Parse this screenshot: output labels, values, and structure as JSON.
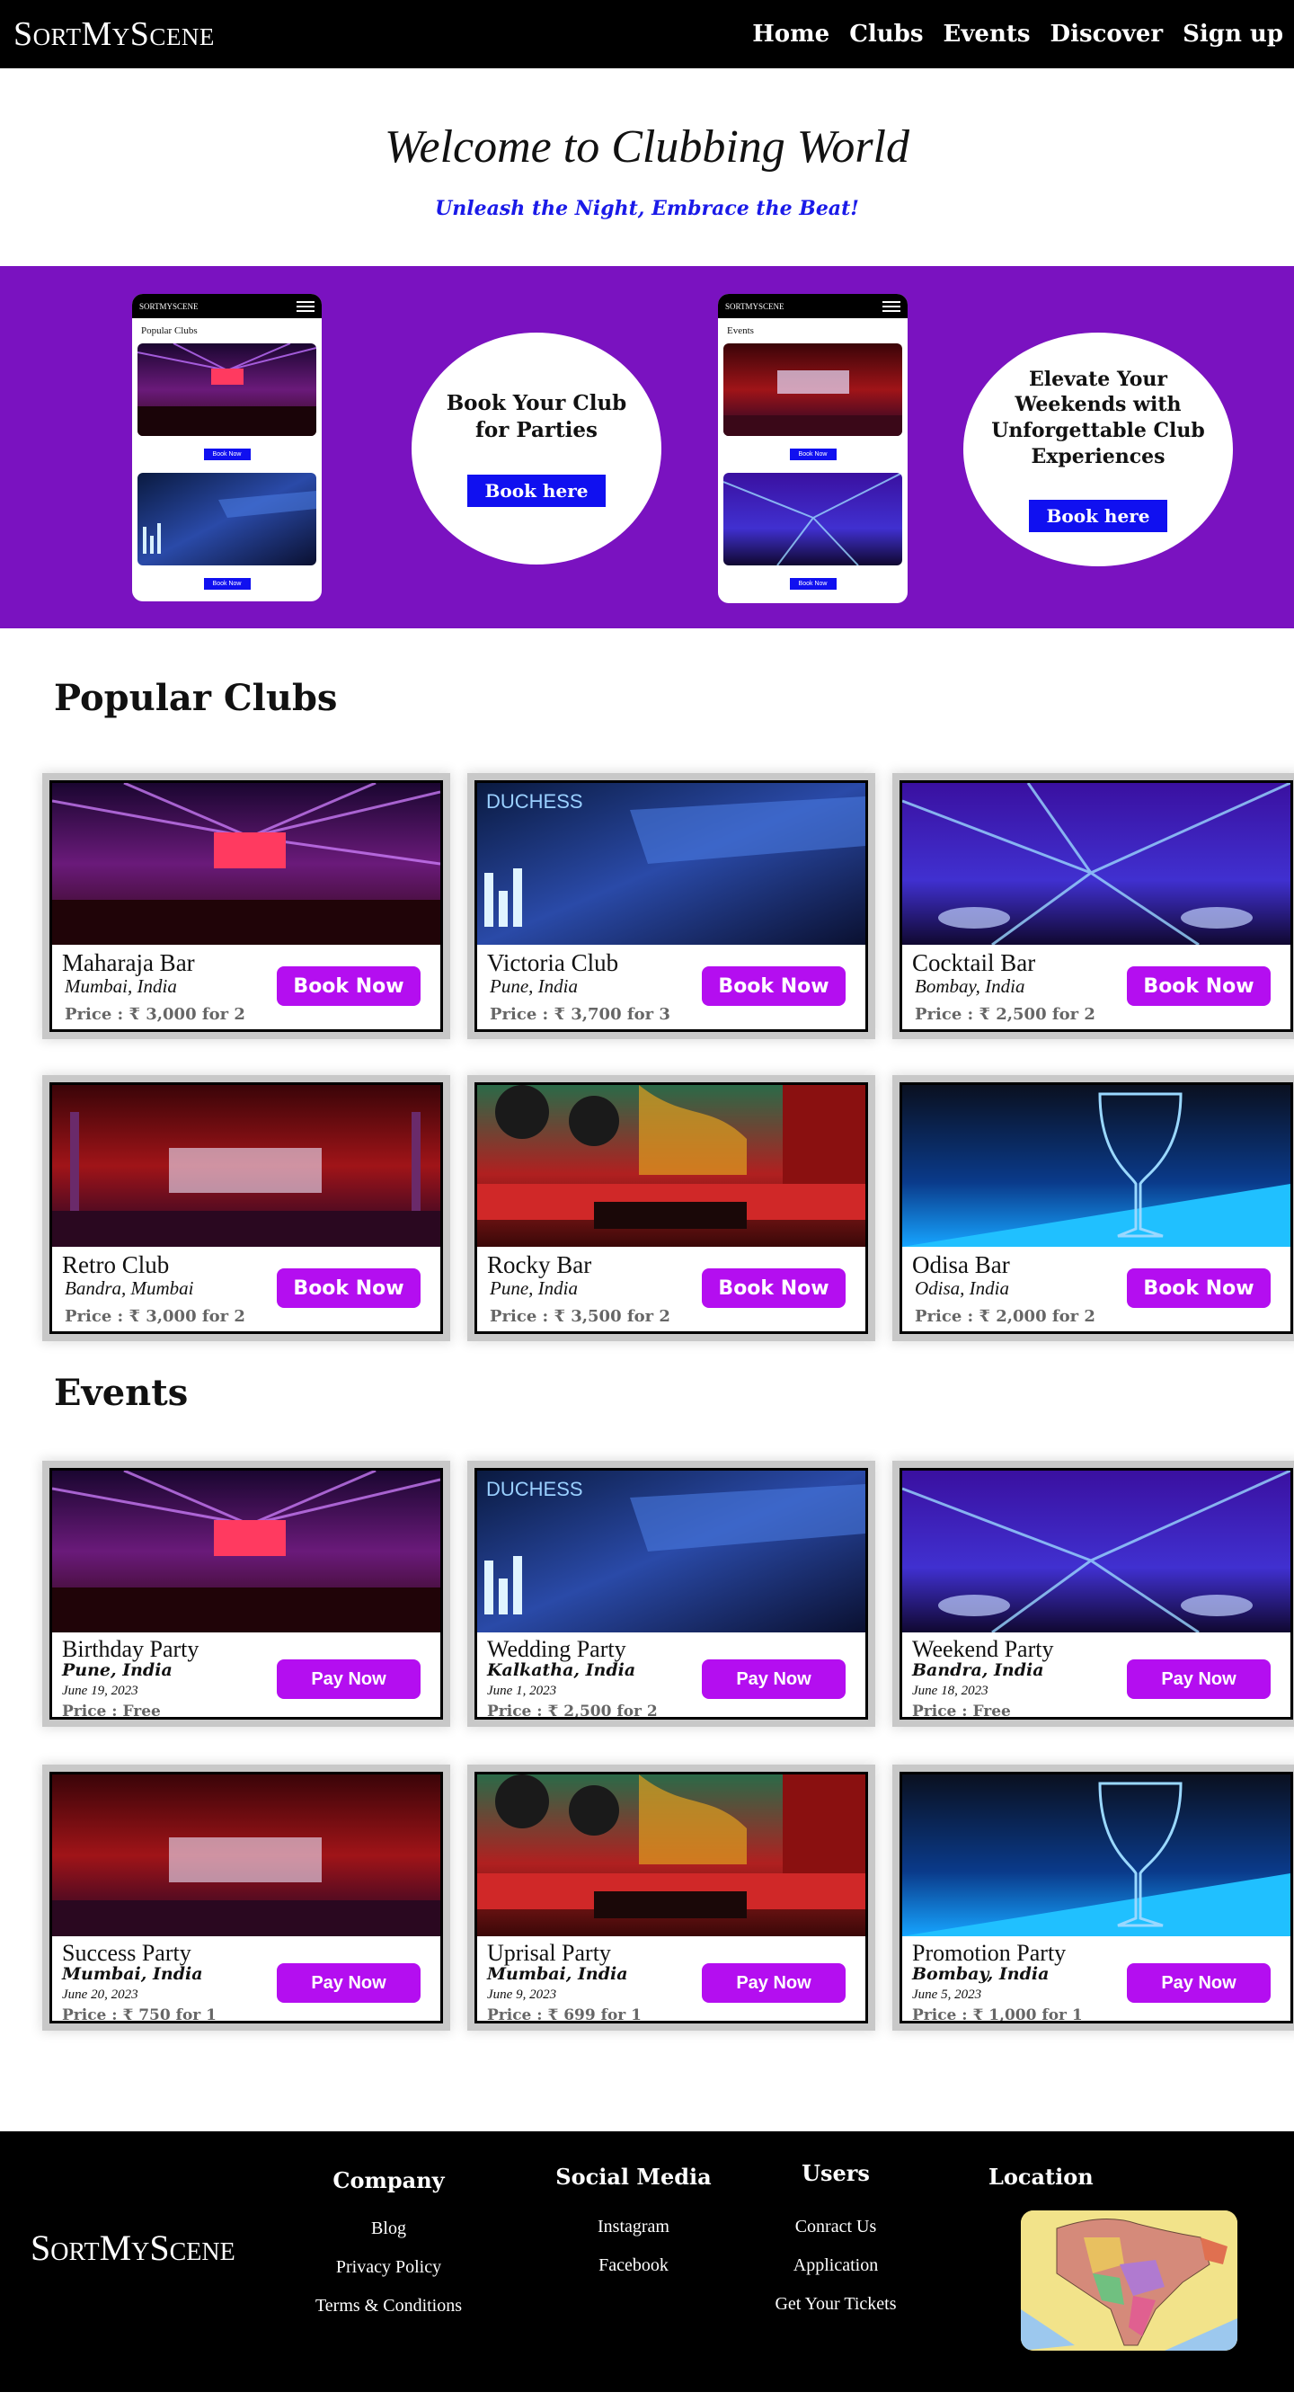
{
  "nav": {
    "logo": "SortMyScene",
    "links": [
      "Home",
      "Clubs",
      "Events",
      "Discover",
      "Sign up"
    ]
  },
  "hero": {
    "title": "Welcome to Clubbing World",
    "subtitle": "Unleash the Night, Embrace the Beat!"
  },
  "banner": {
    "phone1": {
      "brand": "SORTMYSCENE",
      "title": "Popular Clubs",
      "button": "Book Now"
    },
    "circle1": {
      "text": "Book Your Club for Parties",
      "button": "Book here"
    },
    "phone2": {
      "brand": "SORTMYSCENE",
      "title": "Events",
      "button": "Book Now"
    },
    "circle2": {
      "text": "Elevate Your Weekends with Unforgettable Club Experiences",
      "button": "Book here"
    }
  },
  "clubs": {
    "title": "Popular Clubs",
    "button": "Book Now",
    "items": [
      {
        "name": "Maharaja Bar",
        "location": "Mumbai, India",
        "price": "Price : ₹ 3,000 for 2",
        "has_button": true
      },
      {
        "name": "Victoria Club",
        "location": "Pune, India",
        "price": "Price : ₹ 3,700 for 3",
        "has_button": true
      },
      {
        "name": "Cocktail Bar",
        "location": "Bombay, India",
        "price": "Price : ₹ 2,500 for 2",
        "has_button": true
      },
      {
        "name": "Retro Club",
        "location": "Bandra, Mumbai",
        "price": "Price : ₹ 3,000 for 2",
        "has_button": true
      },
      {
        "name": "Rocky Bar",
        "location": "Pune, India",
        "price": "Price : ₹ 3,500 for 2",
        "has_button": true
      },
      {
        "name": "Odisa Bar",
        "location": "Odisa, India",
        "price": "Price : ₹ 2,000 for 2",
        "has_button": true
      }
    ]
  },
  "events": {
    "title": "Events",
    "button": "Pay Now",
    "items": [
      {
        "name": "Birthday Party",
        "location": "Pune, India",
        "date": "June 19, 2023",
        "price": "Price :  Free"
      },
      {
        "name": "Wedding Party",
        "location": "Kalkatha, India",
        "date": "June 1, 2023",
        "price": "Price : ₹ 2,500 for 2"
      },
      {
        "name": "Weekend Party",
        "location": "Bandra, India",
        "date": "June 18, 2023",
        "price": "Price :  Free"
      },
      {
        "name": "Success Party",
        "location": "Mumbai, India",
        "date": "June 20, 2023",
        "price": "Price : ₹ 750 for 1"
      },
      {
        "name": "Uprisal Party",
        "location": "Mumbai, India",
        "date": "June 9, 2023",
        "price": "Price : ₹ 699 for 1"
      },
      {
        "name": "Promotion Party",
        "location": "Bombay, India",
        "date": "June 5, 2023",
        "price": "Price : ₹ 1,000 for 1"
      }
    ]
  },
  "footer": {
    "logo": "SortMyScene",
    "company": {
      "title": "Company",
      "links": [
        "Blog",
        "Privacy Policy",
        "Terms & Conditions"
      ]
    },
    "social": {
      "title": "Social Media",
      "links": [
        "Instagram",
        "Facebook"
      ]
    },
    "users": {
      "title": "Users",
      "links": [
        "Conract Us",
        "Application",
        "Get Your Tickets"
      ]
    },
    "location": {
      "title": "Location"
    }
  },
  "colors": {
    "banner": "#7a12c0",
    "accent_button": "#b40ef0",
    "blue_button": "#1010f0",
    "subtitle": "#1a1ae8"
  }
}
